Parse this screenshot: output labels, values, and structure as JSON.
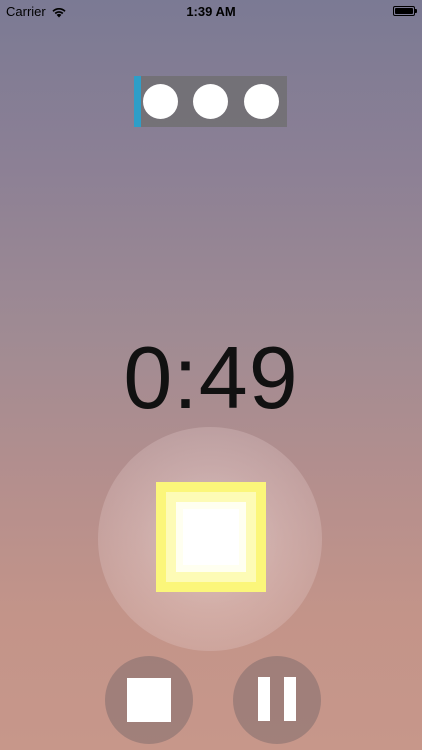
{
  "status_bar": {
    "carrier": "Carrier",
    "time": "1:39 AM",
    "wifi_icon": "wifi-icon",
    "battery_icon": "battery-icon",
    "battery_level": 1.0
  },
  "round_indicator": {
    "dot_count": 3,
    "accent_color": "#2e9ec8"
  },
  "timer": {
    "value": "0:49"
  },
  "main_control": {
    "icon": "glowing-square-icon",
    "glow_color": "#fbf67a"
  },
  "controls": {
    "stop_icon": "stop-icon",
    "pause_icon": "pause-icon"
  }
}
